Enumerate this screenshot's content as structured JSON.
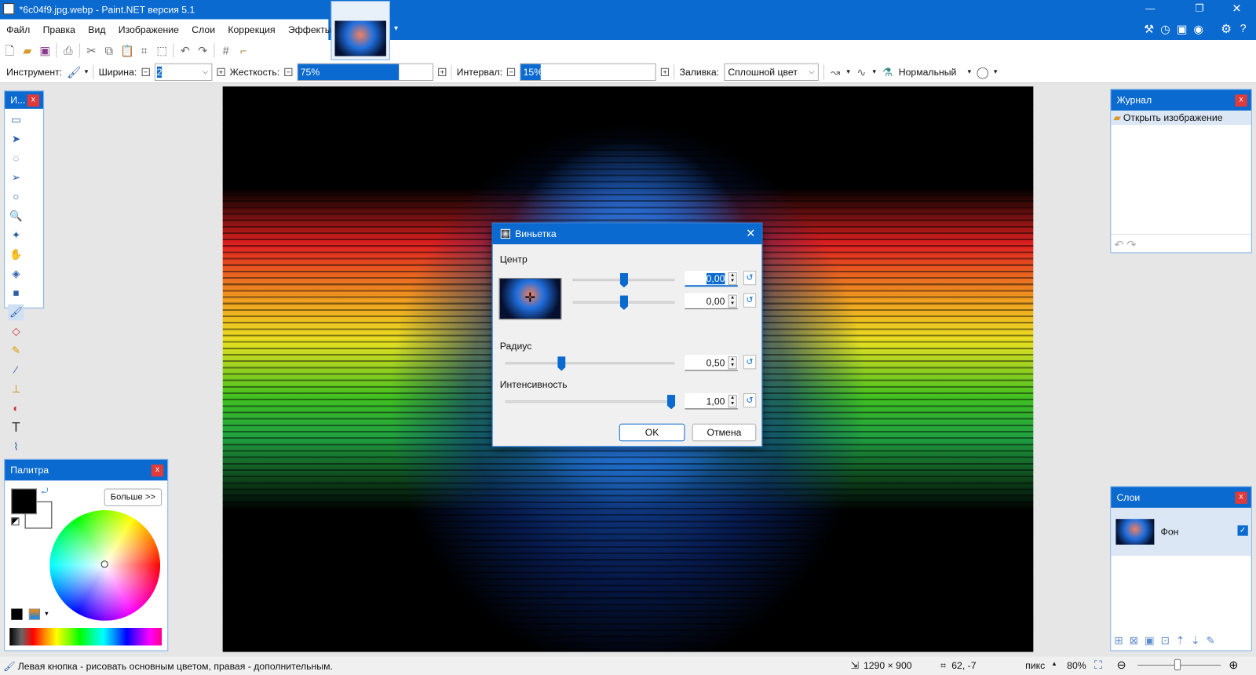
{
  "title": "*6c04f9.jpg.webp - Paint.NET версия 5.1",
  "menu": [
    "Файл",
    "Правка",
    "Вид",
    "Изображение",
    "Слои",
    "Коррекция",
    "Эффекты"
  ],
  "toolbar": {
    "tool_label": "Инструмент:",
    "width_label": "Ширина:",
    "width_value": "2",
    "hardness_label": "Жесткость:",
    "hardness_value": "75%",
    "hardness_pct": 75,
    "interval_label": "Интервал:",
    "interval_value": "15%",
    "interval_pct": 15,
    "fill_label": "Заливка:",
    "fill_value": "Сплошной цвет",
    "blend_value": "Нормальный"
  },
  "tools_panel": {
    "title": "И..."
  },
  "history_panel": {
    "title": "Журнал",
    "items": [
      "Открыть изображение"
    ]
  },
  "palette_panel": {
    "title": "Палитра",
    "more_button": "Больше >>"
  },
  "layers_panel": {
    "title": "Слои",
    "layers": [
      {
        "name": "Фон",
        "visible": true
      }
    ]
  },
  "dialog": {
    "title": "Виньетка",
    "center_label": "Центр",
    "center_x": "0,00",
    "center_y": "0,00",
    "radius_label": "Радиус",
    "radius": "0,50",
    "intensity_label": "Интенсивность",
    "intensity": "1,00",
    "ok": "OK",
    "cancel": "Отмена"
  },
  "status": {
    "hint": "Левая кнопка - рисовать основным цветом, правая - дополнительным.",
    "size": "1290 × 900",
    "cursor": "62, -7",
    "units": "пикс",
    "zoom": "80%"
  }
}
